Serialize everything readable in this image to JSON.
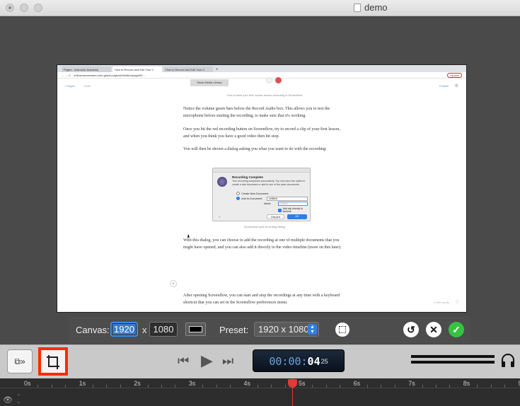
{
  "window": {
    "title": "demo"
  },
  "browser": {
    "tabs": [
      "Pages - Instructor Academy",
      "How to Record and Edit Your C",
      "How to Record and Edit Your C"
    ],
    "address": "onlinecourseinsert-com.ghost.io/ghost/#/editor/page/60...",
    "update_label": "Update"
  },
  "editor": {
    "back_link": "< Pages",
    "status": "Draft",
    "publish": "Publish",
    "media_library": "Stock Media Library",
    "caption_top": "How to start your first course lesson recording in Screenflow",
    "paragraphs": [
      "Notice the volume green bars below the Record Audio box. This allows you to test the microphone before starting the recording, to make sure that it's working.",
      "Once you hit the red recording button on Screenflow, try to record a clip of your first lesson, and when you think you have a good video then hit stop.",
      "You will then be shown a dialog asking you what you want to do with the recording:"
    ],
    "dialog": {
      "title": "Recording Complete",
      "text": "Your recording completed successfully. You now have the option to create a new document or add to one of the open documents.",
      "option_new": "Create New Document",
      "option_add": "Add to Document:",
      "add_target": "Untitled",
      "name_label": "Name:",
      "name_placeholder": "Untitled",
      "checkbox": "Add clip directly to timeline",
      "help": "?",
      "discard": "Discard",
      "ok": "OK"
    },
    "caption_dialog": "Screenflow post-recording dialog",
    "paragraph_after": "With this dialog, you can choose to add the recording at one of multiple documents that you might have opened, and you can also add it directly to the video timeline (more on this later).",
    "paragraph_last": "After opening Screenflow, you can start and stop the recordings at any time with a keyboard shortcut that you can set in the Screenflow preferences menu.",
    "word_count": "1,000 words"
  },
  "canvas_bar": {
    "canvas_label": "Canvas:",
    "width": "1920",
    "x": "x",
    "height": "1080",
    "preset_label": "Preset:",
    "preset_value": "1920 x 1080"
  },
  "transport": {
    "timecode_dim": "00:00:",
    "timecode_sec": "04",
    "timecode_frames": "25"
  },
  "timeline": {
    "ticks": [
      "0s",
      "1s",
      "2s",
      "3s",
      "4s",
      "5s",
      "6s",
      "7s",
      "8s",
      "9"
    ]
  },
  "colors": {
    "accent": "#2f7fe6",
    "crop_highlight": "#ff2a00",
    "confirm": "#35c33f",
    "playhead": "#e53935"
  }
}
